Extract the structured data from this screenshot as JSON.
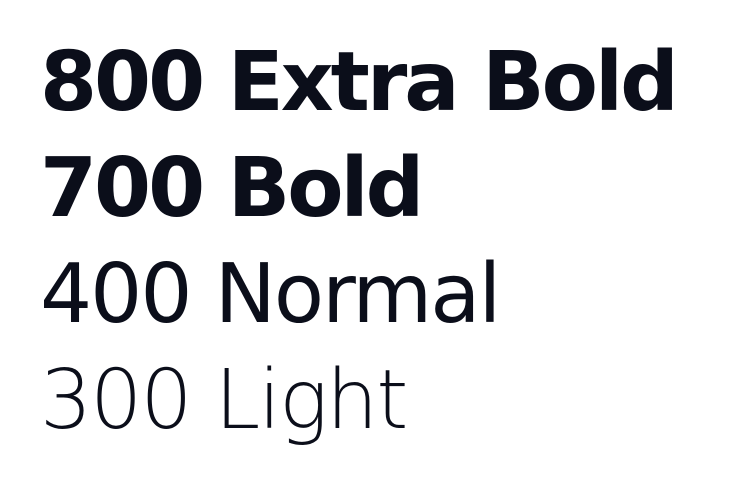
{
  "specimen": {
    "lines": [
      {
        "text": "800 Extra Bold",
        "weight": 800
      },
      {
        "text": "700 Bold",
        "weight": 700
      },
      {
        "text": "400 Normal",
        "weight": 400
      },
      {
        "text": "300 Light",
        "weight": 300
      }
    ],
    "text_color": "#0b0e1a",
    "background_color": "#ffffff"
  }
}
